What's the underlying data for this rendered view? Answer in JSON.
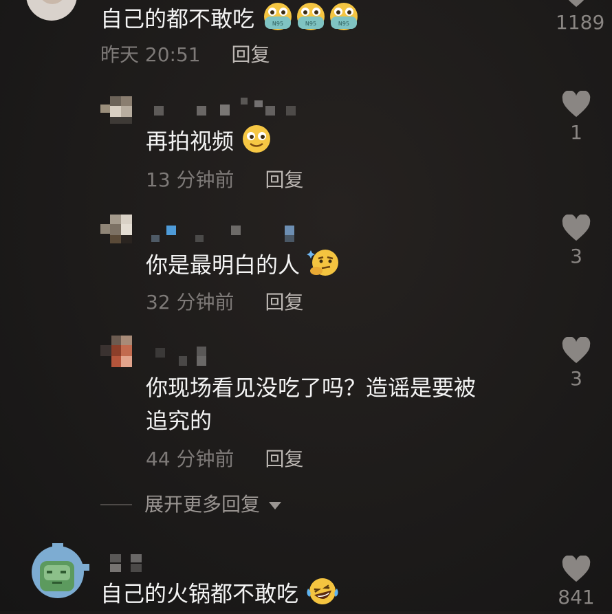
{
  "top_comment": {
    "text": "自己的都不敢吃",
    "time": "昨天 20:51",
    "reply_label": "回复",
    "likes": "1189",
    "emoji": "mask-face-n95",
    "mask_label": "N95"
  },
  "replies": [
    {
      "text": "再拍视频",
      "time": "13 分钟前",
      "reply_label": "回复",
      "likes": "1",
      "emoji": "smiling-face"
    },
    {
      "text": "你是最明白的人",
      "time": "32 分钟前",
      "reply_label": "回复",
      "likes": "3",
      "emoji": "thinking-face"
    },
    {
      "text_line1": "你现场看见没吃了吗？造谣是要被",
      "text_line2": "追究的",
      "time": "44 分钟前",
      "reply_label": "回复",
      "likes": "3"
    }
  ],
  "expand_label": "展开更多回复",
  "second_comment": {
    "text": "自己的火锅都不敢吃",
    "likes": "841",
    "emoji": "laughing-crying-face"
  }
}
